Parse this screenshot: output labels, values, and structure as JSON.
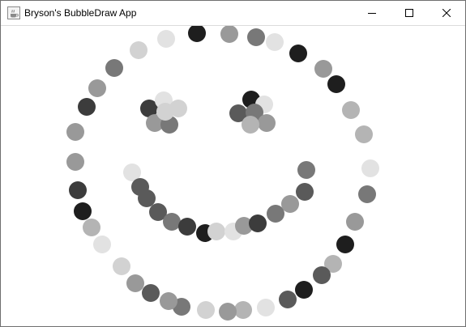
{
  "window": {
    "title": "Bryson's BubbleDraw App"
  },
  "titlebar": {
    "app_icon": "java-cup-icon",
    "minimize_icon": "minimize-icon",
    "maximize_icon": "maximize-icon",
    "close_icon": "close-icon"
  },
  "canvas": {
    "background": "#ffffff",
    "bubble_colors": [
      "#1e1e1e",
      "#3c3c3c",
      "#5a5a5a",
      "#787878",
      "#999999",
      "#b4b4b4",
      "#d2d2d2",
      "#e2e2e2"
    ]
  }
}
